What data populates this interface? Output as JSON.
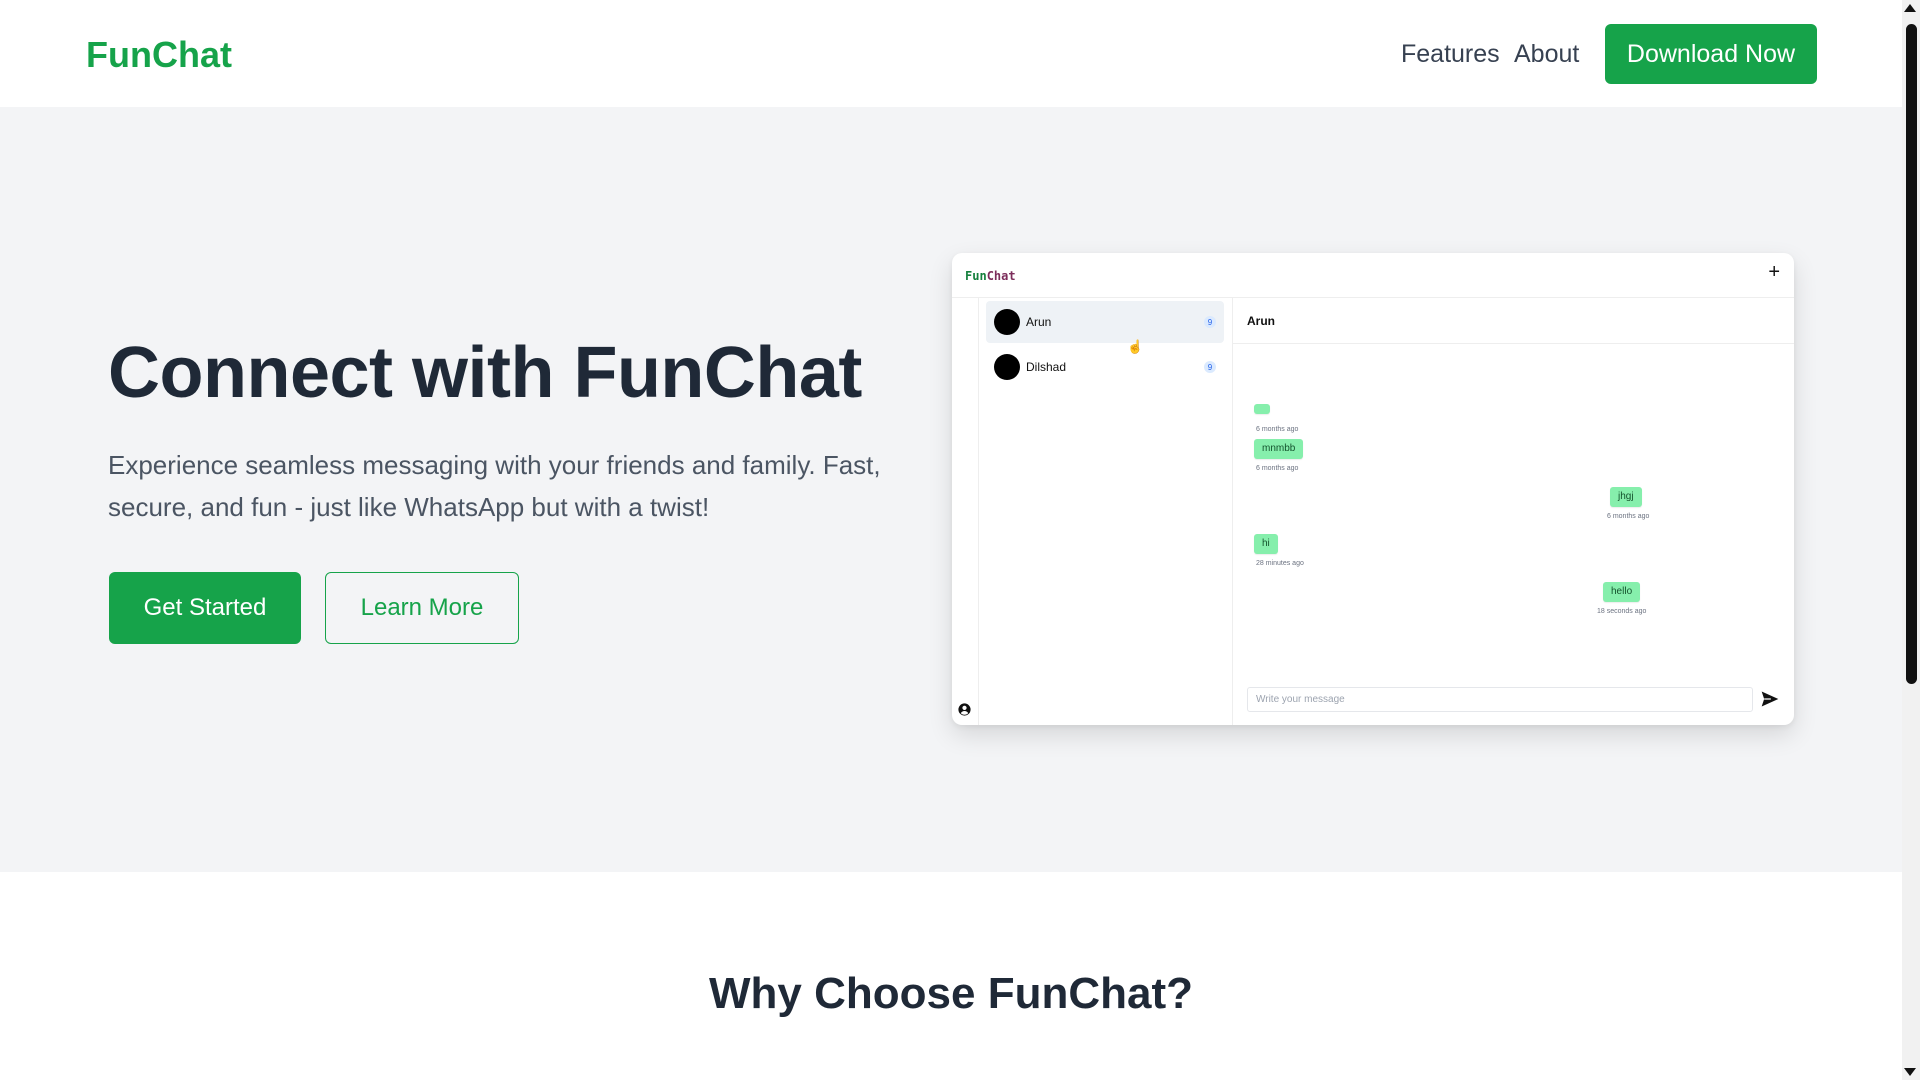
{
  "nav": {
    "brand": "FunChat",
    "links": [
      "Features",
      "About"
    ],
    "cta": "Download Now"
  },
  "hero": {
    "title": "Connect with FunChat",
    "subtitle": "Experience seamless messaging with your friends and family. Fast, secure, and fun - just like WhatsApp but with a twist!",
    "primary_button": "Get Started",
    "secondary_button": "Learn More"
  },
  "mockup": {
    "logo_part1": "Fun",
    "logo_part2": "Chat",
    "new_chat_icon": "plus-icon",
    "contacts": [
      {
        "name": "Arun",
        "badge": "9"
      },
      {
        "name": "Dilshad",
        "badge": "9"
      }
    ],
    "active_chat": "Arun",
    "messages": [
      {
        "text": "",
        "side": "left",
        "time": "6 months ago"
      },
      {
        "text": "mnmbb",
        "side": "left",
        "time": "6 months ago"
      },
      {
        "text": "jhgj",
        "side": "right",
        "time": "6 months ago"
      },
      {
        "text": "hi",
        "side": "left",
        "time": "28 minutes ago"
      },
      {
        "text": "hello",
        "side": "right",
        "time": "18 seconds ago"
      }
    ],
    "input_placeholder": "Write your message",
    "send_icon": "send-icon",
    "user_icon": "user-circle-icon"
  },
  "features": {
    "title": "Why Choose FunChat?"
  },
  "colors": {
    "brand_green": "#16a34a",
    "bubble_green": "#86efac",
    "hero_bg": "#f3f4f6"
  }
}
